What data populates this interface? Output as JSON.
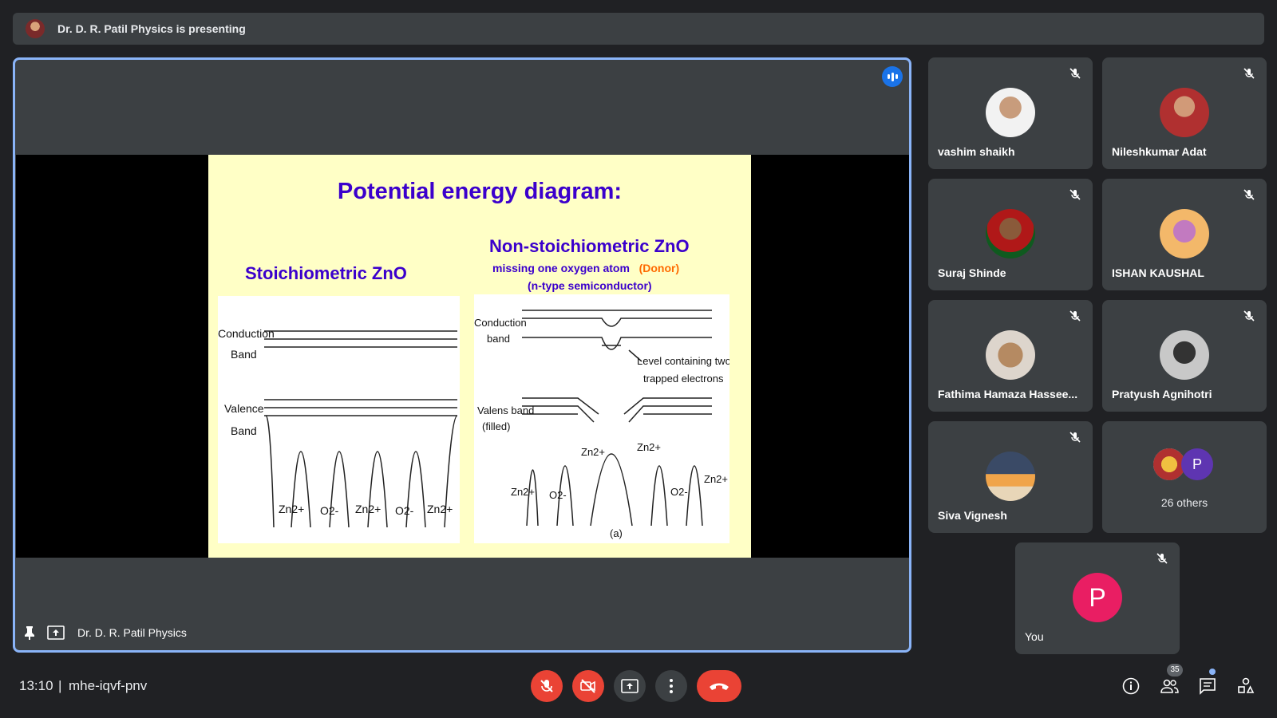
{
  "banner": {
    "presenting_text": "Dr. D. R. Patil Physics is presenting"
  },
  "slide": {
    "title": "Potential energy diagram:",
    "left_heading": "Stoichiometric ZnO",
    "right_heading": "Non-stoichiometric ZnO",
    "right_sub_1": "missing one oxygen atom",
    "right_sub_1_paren": "(Donor)",
    "right_sub_2": "(n-type semiconductor)",
    "left_diagram": {
      "conduction_label_1": "Conduction",
      "conduction_label_2": "Band",
      "valence_label_1": "Valence",
      "valence_label_2": "Band",
      "ions": [
        "Zn2+",
        "O2-",
        "Zn2+",
        "O2-",
        "Zn2+"
      ]
    },
    "right_diagram": {
      "conduction_label_1": "Conduction",
      "conduction_label_2": "band",
      "level_label_1": "Level containing two",
      "level_label_2": "trapped electrons",
      "valens_label_1": "Valens band",
      "valens_label_2": "(filled)",
      "ions": [
        "Zn2+",
        "O2-",
        "Zn2+",
        "Zn2+",
        "O2-",
        "Zn2+"
      ],
      "caption": "(a)"
    }
  },
  "presenter": {
    "name": "Dr. D. R. Patil Physics"
  },
  "participants": [
    {
      "name": "vashim shaikh",
      "muted": true
    },
    {
      "name": "Nileshkumar Adat",
      "muted": true
    },
    {
      "name": "Suraj Shinde",
      "muted": true
    },
    {
      "name": "ISHAN KAUSHAL",
      "muted": true
    },
    {
      "name": "Fathima Hamaza Hassee...",
      "muted": true
    },
    {
      "name": "Pratyush Agnihotri",
      "muted": true
    },
    {
      "name": "Siva Vignesh",
      "muted": true
    }
  ],
  "others": {
    "label": "26 others",
    "avatar_letter": "P"
  },
  "self": {
    "name": "You",
    "avatar_letter": "P",
    "avatar_color": "#e91e63"
  },
  "bottom_bar": {
    "time": "13:10",
    "separator": "|",
    "meeting_code": "mhe-iqvf-pnv",
    "people_count": "35"
  },
  "colors": {
    "background": "#202124",
    "tile": "#3c4043",
    "accent": "#8ab4f8",
    "danger": "#ea4335"
  }
}
